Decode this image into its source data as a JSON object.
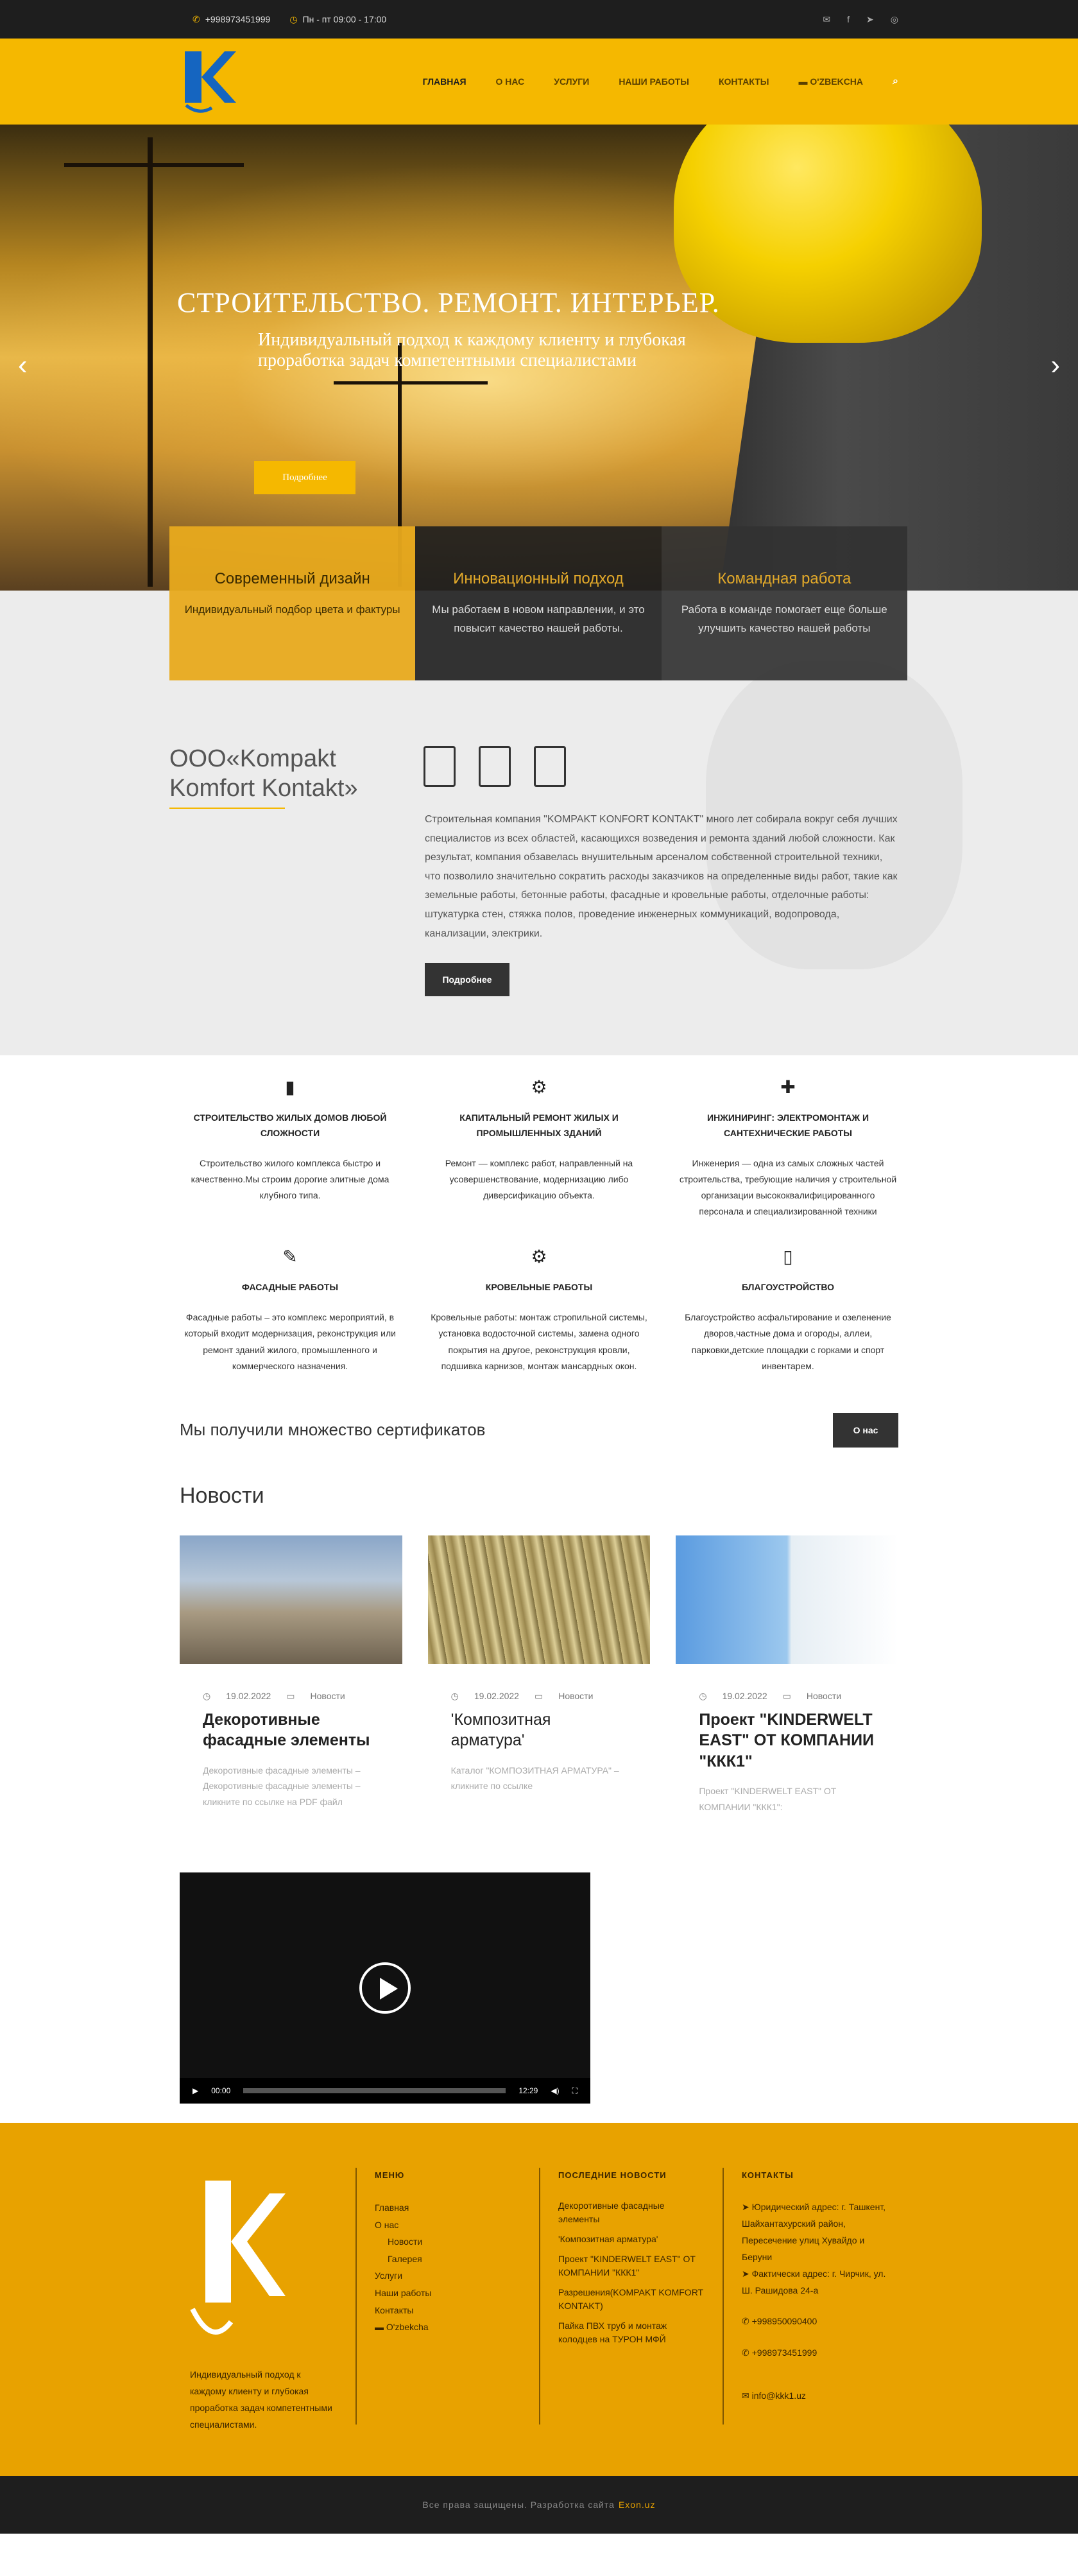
{
  "topbar": {
    "phone": "+998973451999",
    "hours": "Пн - пт 09:00 - 17:00",
    "social_icons": [
      "mail-icon",
      "facebook-icon",
      "telegram-icon",
      "instagram-icon"
    ]
  },
  "nav": {
    "items": [
      "ГЛАВНАЯ",
      "О НАС",
      "УСЛУГИ",
      "НАШИ РАБОТЫ",
      "КОНТАКТЫ",
      "O'ZBEKCHA"
    ]
  },
  "hero": {
    "title": "СТРОИТЕЛЬСТВО. РЕМОНТ. ИНТЕРЬЕР.",
    "subtitle": "Индивидуальный подход к каждому клиенту и глубокая проработка задач компетентными специалистами",
    "button": "Подробнее"
  },
  "features": [
    {
      "title": "Современный дизайн",
      "text": "Индивидуальный подбор цвета и фактуры"
    },
    {
      "title": "Инновационный подход",
      "text": "Мы работаем в новом направлении, и это повысит качество нашей работы."
    },
    {
      "title": "Командная работа",
      "text": "Работа в команде помогает еще больше улучшить качество нашей работы"
    }
  ],
  "about": {
    "title_line1": "ООО«Kompakt",
    "title_line2": "Komfort Kontakt»",
    "text": "Строительная компания \"KOMPAKT KONFORT KONTAKT\" много лет собирала вокруг себя лучших специалистов из всех областей, касающихся возведения и ремонта зданий любой сложности. Как результат, компания обзавелась внушительным арсеналом собственной строительной техники, что позволило значительно сократить расходы заказчиков на определенные виды работ, такие как земельные работы, бетонные работы, фасадные и кровельные работы, отделочные работы: штукатурка стен, стяжка полов, проведение инженерных коммуникаций, водопровода, канализации, электрики.",
    "button": "Подробнее"
  },
  "services": [
    {
      "icon": "building-icon",
      "glyph": "▮",
      "title": "СТРОИТЕЛЬСТВО ЖИЛЫХ ДОМОВ ЛЮБОЙ СЛОЖНОСТИ",
      "text": "Строительство жилого комплекса быстро и качественно.Мы строим дорогие элитные дома клубного типа."
    },
    {
      "icon": "gear-icon",
      "glyph": "⚙",
      "title": "КАПИТАЛЬНЫЙ РЕМОНТ ЖИЛЫХ И ПРОМЫШЛЕННЫХ ЗДАНИЙ",
      "text": "Ремонт — комплекс работ, направленный на усовершенствование, модернизацию либо диверсификацию объекта."
    },
    {
      "icon": "puzzle-icon",
      "glyph": "✚",
      "title": "ИНЖИНИРИНГ: ЭЛЕКТРОМОНТАЖ И САНТЕХНИЧЕСКИЕ РАБОТЫ",
      "text": "Инженерия  — одна из самых сложных частей строительства, требующие наличия у строительной организации высококвалифицированного персонала и специализированной техники"
    },
    {
      "icon": "eyedropper-icon",
      "glyph": "✎",
      "title": "ФАСАДНЫЕ РАБОТЫ",
      "text": "Фасадные работы – это комплекс мероприятий, в который входит модернизация, реконструкция или ремонт зданий  жилого, промышленного и коммерческого  назначения."
    },
    {
      "icon": "cogs-icon",
      "glyph": "⚙",
      "title": "КРОВЕЛЬНЫЕ РАБОТЫ",
      "text": "Кровельные работы: монтаж стропильной системы, установка водосточной системы, замена одного покрытия на другое, реконструкция кровли, подшивка карнизов, монтаж мансардных окон."
    },
    {
      "icon": "tablet-icon",
      "glyph": "▯",
      "title": "БЛАГОУСТРОЙСТВО",
      "text": "Благоустройство асфальтирование и озеленение дворов,частные дома и огороды, аллеи, парковки,детские площадки с горками и спорт инвентарем."
    }
  ],
  "certs": {
    "text": "Мы получили множество сертификатов",
    "button": "О нас"
  },
  "news": {
    "title": "Новости",
    "items": [
      {
        "date": "19.02.2022",
        "category": "Новости",
        "title": "Декоротивные фасадные элементы",
        "excerpt": "Декоротивные фасадные элементы – Декоротивные фасадные элементы – кликните по ссылке на PDF файл"
      },
      {
        "date": "19.02.2022",
        "category": "Новости",
        "title": "'Композитная арматура'",
        "excerpt": "Каталог \"КОМПОЗИТНАЯ АРМАТУРА\" – кликните по ссылке"
      },
      {
        "date": "19.02.2022",
        "category": "Новости",
        "title": "Проект \"KINDERWELT EAST\" ОТ КОМПАНИИ \"ККК1\"",
        "excerpt": "Проект \"KINDERWELT EAST\" ОТ КОМПАНИИ \"ККК1\":"
      }
    ]
  },
  "video": {
    "time_current": "00:00",
    "time_total": "12:29"
  },
  "footer": {
    "tagline": "Индивидуальный подход к каждому клиенту и глубокая проработка задач компетентными специалистами.",
    "menu_title": "МЕНЮ",
    "menu": [
      "Главная",
      "О нас",
      "Новости",
      "Галерея",
      "Услуги",
      "Наши работы",
      "Контакты",
      "O'zbekcha"
    ],
    "news_title": "ПОСЛЕДНИЕ НОВОСТИ",
    "latest": [
      "Декоротивные фасадные элементы",
      "'Композитная арматура'",
      "Проект \"KINDERWELT EAST\" ОТ КОМПАНИИ \"ККК1\"",
      "Разрешения(KOMPAKT KOMFORT KONTAKT)",
      "Пайка ПВХ труб и монтаж колодцев на ТУРОН МФЙ"
    ],
    "contacts_title": "КОНТАКТЫ",
    "legal_address": "Юридический адрес: г. Ташкент, Шайхантахурский район, Пересечение улиц Хувайдо и Беруни",
    "actual_address": "Фактически адрес: г. Чирчик, ул. Ш. Рашидова 24-а",
    "phone1": "+998950090400",
    "phone2": "+998973451999",
    "email": "info@kkk1.uz"
  },
  "copyright": {
    "text": "Все права защищены. Разработка сайта",
    "link": "Exon.uz"
  }
}
